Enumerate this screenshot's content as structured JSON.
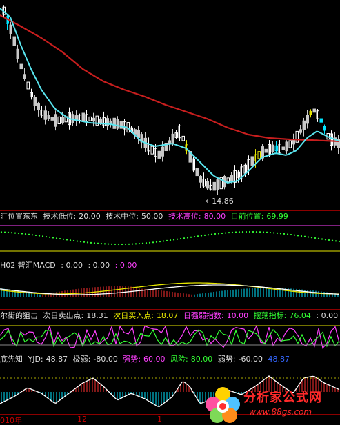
{
  "colors": {
    "bg": "#000000",
    "up": "#ffffff",
    "down": "#c8c8c8",
    "ma_short": "#59e6f0",
    "ma_long": "#c81e1e",
    "divider": "#8b0000",
    "yellow": "#e6e600",
    "magenta": "#ff40ff",
    "green": "#33ff33",
    "cyan": "#00e5ff",
    "blue": "#3366ff",
    "red": "#ff3030"
  },
  "main": {
    "low_label": "←14.86"
  },
  "panel1": {
    "name": "汇位置东东",
    "l1": "技术低位:",
    "v1": "20.00",
    "l2": "技术中位:",
    "v2": "50.00",
    "l3": "技术高位:",
    "v3": "80.00",
    "l4": "目前位置:",
    "v4": "69.99"
  },
  "panel2": {
    "name": "H02 智汇MACD",
    "v1": ": 0.00",
    "v2": ": 0.00",
    "v3": ": 0.00"
  },
  "panel3": {
    "name": "尔街的狙击",
    "l1": "次日卖出点:",
    "v1": "18.31",
    "l2": "次日买入点:",
    "v2": "18.07",
    "l3": "日强弱指数:",
    "v3": "10.00",
    "l4": "摆荡指标:",
    "v4": "76.04",
    "v5": ": 0.00"
  },
  "panel4": {
    "name": "底先知",
    "l1": "YJD:",
    "v1": "48.87",
    "l2": "极弱:",
    "v2": "-80.00",
    "l3": "强势:",
    "v3": "60.00",
    "l4": "风险:",
    "v4": "80.00",
    "l5": "弱势:",
    "v5": "-60.00",
    "v6": "48.87"
  },
  "time_axis": {
    "t1": "010年",
    "t2": "12",
    "t3": "1"
  },
  "watermark": {
    "title": "分析家公式网",
    "url": "www.88gs.com"
  }
}
